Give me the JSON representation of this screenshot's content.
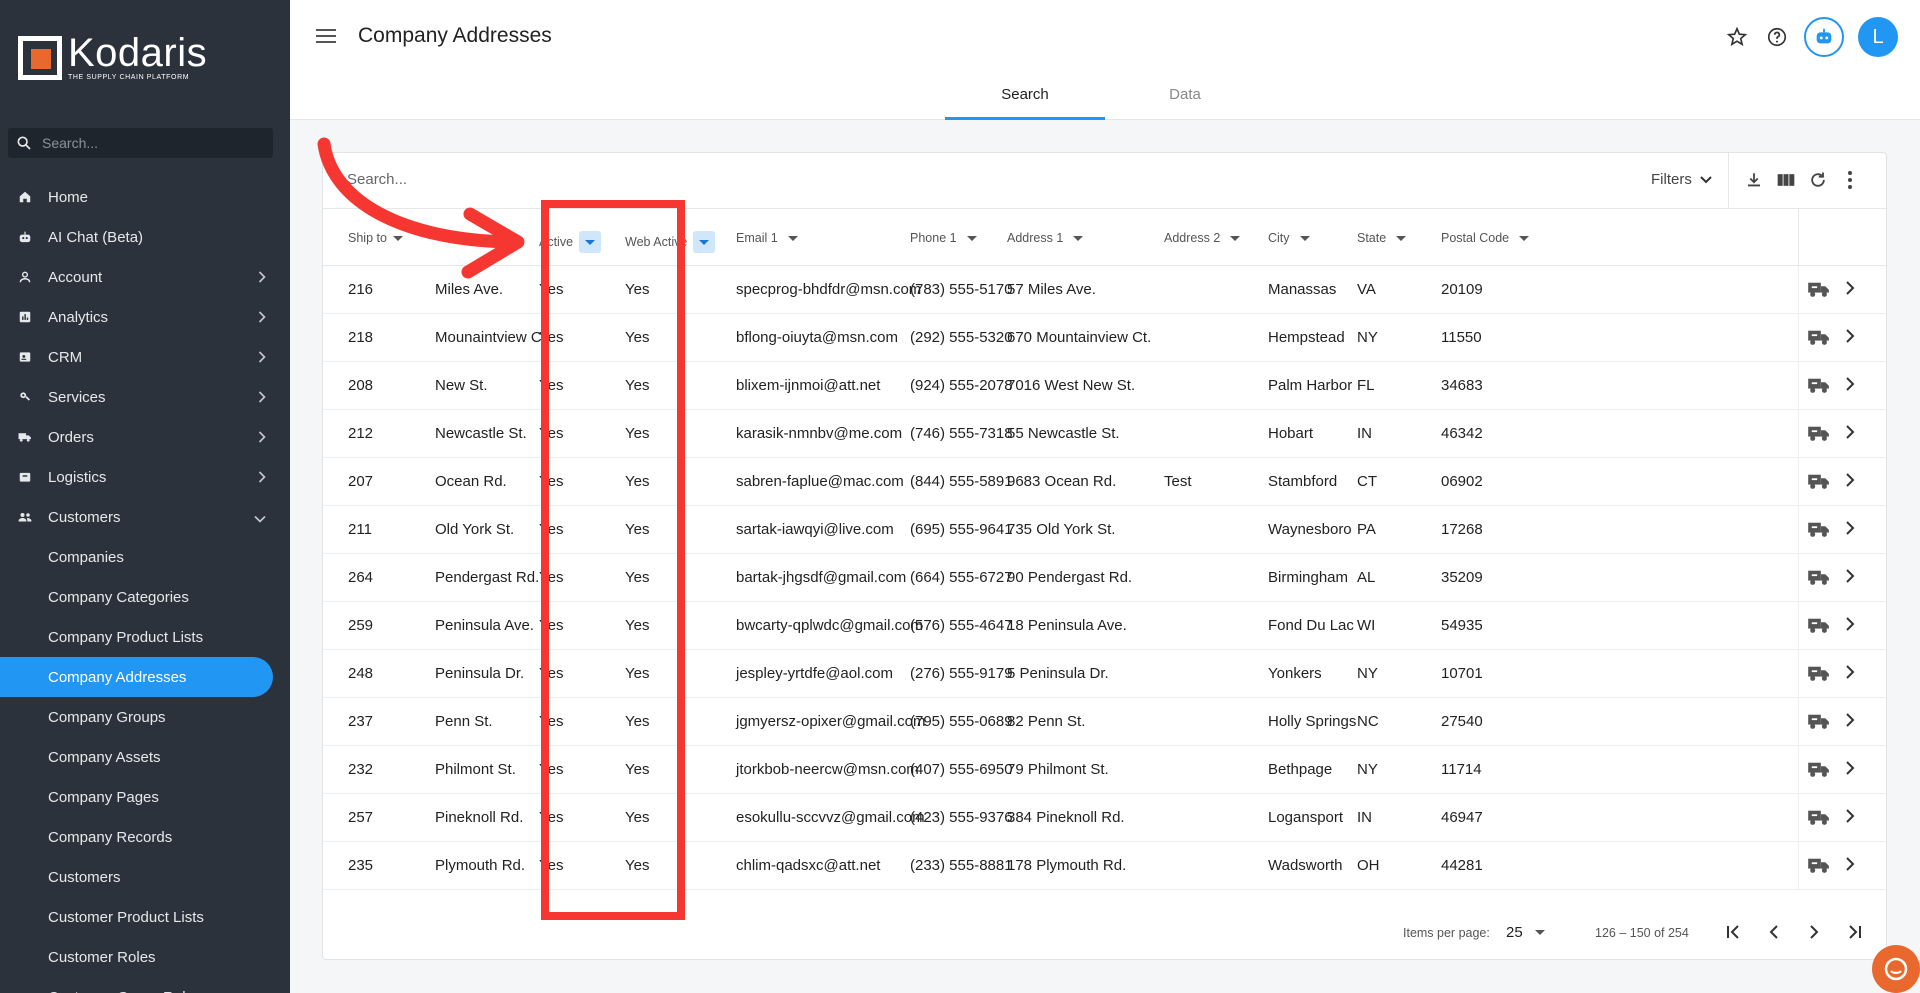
{
  "app": {
    "logo_name": "Kodaris",
    "logo_tagline": "THE SUPPLY CHAIN PLATFORM"
  },
  "sidebar": {
    "search_placeholder": "Search...",
    "items": [
      {
        "label": "Home",
        "icon": "home-icon",
        "has_chevron": false
      },
      {
        "label": "AI Chat (Beta)",
        "icon": "robot-icon",
        "has_chevron": false
      },
      {
        "label": "Account",
        "icon": "person-icon",
        "has_chevron": true
      },
      {
        "label": "Analytics",
        "icon": "chart-icon",
        "has_chevron": true
      },
      {
        "label": "CRM",
        "icon": "contact-card-icon",
        "has_chevron": true
      },
      {
        "label": "Services",
        "icon": "wrench-icon",
        "has_chevron": true
      },
      {
        "label": "Orders",
        "icon": "truck-icon",
        "has_chevron": true
      },
      {
        "label": "Logistics",
        "icon": "box-icon",
        "has_chevron": true
      },
      {
        "label": "Customers",
        "icon": "group-icon",
        "has_chevron": true,
        "expanded": true
      }
    ],
    "sub_items": [
      "Companies",
      "Company Categories",
      "Company Product Lists",
      "Company Addresses",
      "Company Groups",
      "Company Assets",
      "Company Pages",
      "Company Records",
      "Customers",
      "Customer Product Lists",
      "Customer Roles",
      "Customer Group Roles"
    ],
    "active_sub_item": "Company Addresses"
  },
  "header": {
    "title": "Company Addresses",
    "avatar_letter": "L",
    "tabs": [
      {
        "label": "Search",
        "active": true
      },
      {
        "label": "Data",
        "active": false
      }
    ]
  },
  "toolbar": {
    "search_placeholder": "Search...",
    "filters_label": "Filters"
  },
  "table": {
    "columns": [
      {
        "key": "ship_to",
        "label": "Ship to"
      },
      {
        "key": "name",
        "label": ""
      },
      {
        "key": "active",
        "label": "Active"
      },
      {
        "key": "web_active",
        "label": "Web Active"
      },
      {
        "key": "email1",
        "label": "Email 1"
      },
      {
        "key": "phone1",
        "label": "Phone 1"
      },
      {
        "key": "address1",
        "label": "Address 1"
      },
      {
        "key": "address2",
        "label": "Address 2"
      },
      {
        "key": "city",
        "label": "City"
      },
      {
        "key": "state",
        "label": "State"
      },
      {
        "key": "postal",
        "label": "Postal Code"
      }
    ],
    "rows": [
      {
        "ship_to": "216",
        "name": "Miles Ave.",
        "active": "Yes",
        "web_active": "Yes",
        "email1": "specprog-bhdfdr@msn.com",
        "phone1": "(783) 555-5170",
        "address1": "57 Miles Ave.",
        "address2": "",
        "city": "Manassas",
        "state": "VA",
        "postal": "20109"
      },
      {
        "ship_to": "218",
        "name": "Mounaintview Ct.",
        "active": "Yes",
        "web_active": "Yes",
        "email1": "bflong-oiuyta@msn.com",
        "phone1": "(292) 555-5320",
        "address1": "670 Mountainview Ct.",
        "address2": "",
        "city": "Hempstead",
        "state": "NY",
        "postal": "11550"
      },
      {
        "ship_to": "208",
        "name": "New St.",
        "active": "Yes",
        "web_active": "Yes",
        "email1": "blixem-ijnmoi@att.net",
        "phone1": "(924) 555-2078",
        "address1": "7016 West New St.",
        "address2": "",
        "city": "Palm Harbor",
        "state": "FL",
        "postal": "34683"
      },
      {
        "ship_to": "212",
        "name": "Newcastle St.",
        "active": "Yes",
        "web_active": "Yes",
        "email1": "karasik-nmnbv@me.com",
        "phone1": "(746) 555-7318",
        "address1": "55 Newcastle St.",
        "address2": "",
        "city": "Hobart",
        "state": "IN",
        "postal": "46342"
      },
      {
        "ship_to": "207",
        "name": "Ocean Rd.",
        "active": "Yes",
        "web_active": "Yes",
        "email1": "sabren-faplue@mac.com",
        "phone1": "(844) 555-5891",
        "address1": "9683 Ocean Rd.",
        "address2": "Test",
        "city": "Stambford",
        "state": "CT",
        "postal": "06902"
      },
      {
        "ship_to": "211",
        "name": "Old York St.",
        "active": "Yes",
        "web_active": "Yes",
        "email1": "sartak-iawqyi@live.com",
        "phone1": "(695) 555-9641",
        "address1": "735 Old York St.",
        "address2": "",
        "city": "Waynesboro",
        "state": "PA",
        "postal": "17268"
      },
      {
        "ship_to": "264",
        "name": "Pendergast Rd.",
        "active": "Yes",
        "web_active": "Yes",
        "email1": "bartak-jhgsdf@gmail.com",
        "phone1": "(664) 555-6727",
        "address1": "90 Pendergast Rd.",
        "address2": "",
        "city": "Birmingham",
        "state": "AL",
        "postal": "35209"
      },
      {
        "ship_to": "259",
        "name": "Peninsula Ave.",
        "active": "Yes",
        "web_active": "Yes",
        "email1": "bwcarty-qplwdc@gmail.com",
        "phone1": "(576) 555-4647",
        "address1": "18 Peninsula Ave.",
        "address2": "",
        "city": "Fond Du Lac",
        "state": "WI",
        "postal": "54935"
      },
      {
        "ship_to": "248",
        "name": "Peninsula Dr.",
        "active": "Yes",
        "web_active": "Yes",
        "email1": "jespley-yrtdfe@aol.com",
        "phone1": "(276) 555-9179",
        "address1": "5 Peninsula Dr.",
        "address2": "",
        "city": "Yonkers",
        "state": "NY",
        "postal": "10701"
      },
      {
        "ship_to": "237",
        "name": "Penn St.",
        "active": "Yes",
        "web_active": "Yes",
        "email1": "jgmyersz-opixer@gmail.com",
        "phone1": "(795) 555-0689",
        "address1": "82 Penn St.",
        "address2": "",
        "city": "Holly Springs",
        "state": "NC",
        "postal": "27540"
      },
      {
        "ship_to": "232",
        "name": "Philmont St.",
        "active": "Yes",
        "web_active": "Yes",
        "email1": "jtorkbob-neercw@msn.com",
        "phone1": "(407) 555-6950",
        "address1": "79 Philmont St.",
        "address2": "",
        "city": "Bethpage",
        "state": "NY",
        "postal": "11714"
      },
      {
        "ship_to": "257",
        "name": "Pineknoll Rd.",
        "active": "Yes",
        "web_active": "Yes",
        "email1": "esokullu-sccvvz@gmail.com",
        "phone1": "(423) 555-9376",
        "address1": "384 Pineknoll Rd.",
        "address2": "",
        "city": "Logansport",
        "state": "IN",
        "postal": "46947"
      },
      {
        "ship_to": "235",
        "name": "Plymouth Rd.",
        "active": "Yes",
        "web_active": "Yes",
        "email1": "chlim-qadsxc@att.net",
        "phone1": "(233) 555-8881",
        "address1": "178 Plymouth Rd.",
        "address2": "",
        "city": "Wadsworth",
        "state": "OH",
        "postal": "44281"
      }
    ]
  },
  "pagination": {
    "items_per_page_label": "Items per page:",
    "items_per_page": "25",
    "range_label": "126 – 150 of 254"
  },
  "colors": {
    "accent": "#2196f3",
    "sidebar_bg": "#2b323b",
    "annotation": "#f53631",
    "brand_orange": "#e8682d"
  }
}
